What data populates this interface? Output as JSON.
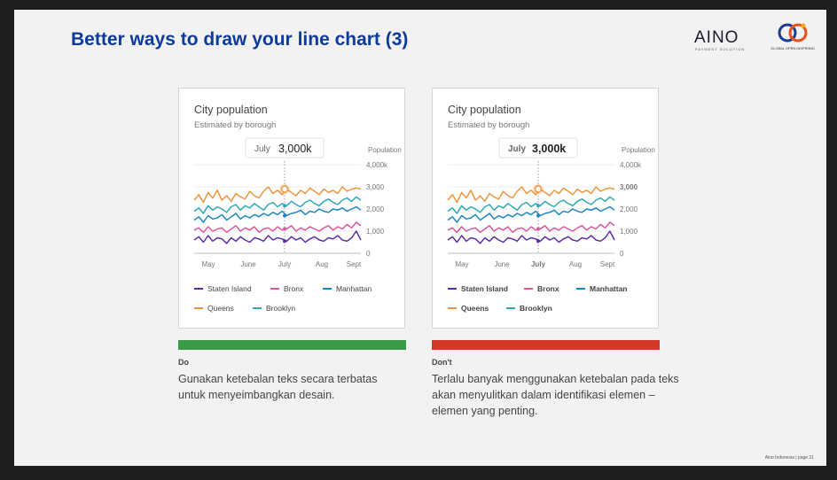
{
  "slide": {
    "title": "Better ways to draw your line chart (3)",
    "logos": {
      "aino_text": "AINO",
      "aino_tagline": "PAYMENT SOLUTION",
      "goi_text": "GLOBAL OPEN INSPIRING"
    },
    "footer": "Aino Indonesia | page 31"
  },
  "colors": {
    "title": "#0d3b9c",
    "do_bar": "#3a9a48",
    "dont_bar": "#d23a27",
    "staten_island": "#5b2ca8",
    "bronx": "#d9579b",
    "manhattan": "#1a86c6",
    "queens": "#f0943c",
    "brooklyn": "#2fa9b3",
    "highlight": "#f0943c"
  },
  "panels": [
    {
      "id": "do",
      "verdict": "Do",
      "description": "Gunakan ketebalan teks secara terbatas untuk menyeimbangkan desain.",
      "bold_emphasis": false
    },
    {
      "id": "dont",
      "verdict": "Don't",
      "description": "Terlalu banyak menggunakan ketebalan pada teks akan menyulitkan dalam identifikasi elemen – elemen yang penting.",
      "bold_emphasis": true
    }
  ],
  "chart_data": {
    "type": "line",
    "title": "City population",
    "subtitle": "Estimated by borough",
    "ylabel": "Population",
    "ylim": [
      0,
      4000
    ],
    "y_ticks": [
      "4,000k",
      "3,000",
      "2,000",
      "1,000",
      "0"
    ],
    "y_tick_values": [
      4000,
      3000,
      2000,
      1000,
      0
    ],
    "x_ticks": [
      "May",
      "June",
      "July",
      "Aug",
      "Sept"
    ],
    "tooltip": {
      "month": "July",
      "value": "3,000k"
    },
    "series": [
      {
        "name": "Staten Island",
        "color": "#5b2ca8",
        "values": [
          600,
          750,
          500,
          800,
          550,
          700,
          650,
          450,
          700,
          550,
          750,
          600,
          500,
          700,
          650,
          550,
          800,
          600,
          700,
          650,
          550,
          750,
          600,
          700,
          500,
          650,
          750,
          600,
          550,
          700,
          650,
          800,
          600,
          550,
          700,
          1000,
          600
        ]
      },
      {
        "name": "Bronx",
        "color": "#d9579b",
        "values": [
          1050,
          1150,
          950,
          1200,
          1000,
          1100,
          1150,
          950,
          1100,
          1250,
          1000,
          1150,
          1050,
          1200,
          950,
          1100,
          1150,
          1000,
          1200,
          1050,
          1100,
          1250,
          1000,
          1150,
          1050,
          1200,
          1100,
          1000,
          1150,
          1250,
          1050,
          1200,
          1100,
          1300,
          1150,
          1400,
          1250
        ]
      },
      {
        "name": "Manhattan",
        "color": "#1a86c6",
        "values": [
          1500,
          1650,
          1400,
          1700,
          1550,
          1600,
          1750,
          1500,
          1650,
          1800,
          1550,
          1700,
          1600,
          1750,
          1650,
          1800,
          1700,
          1850,
          1750,
          1900,
          1700,
          1800,
          1850,
          1950,
          1750,
          1900,
          1850,
          2000,
          1900,
          1850,
          2000,
          1950,
          2050,
          1900,
          2000,
          2100,
          1950
        ]
      },
      {
        "name": "Queens",
        "color": "#f0943c",
        "values": [
          2400,
          2650,
          2300,
          2750,
          2500,
          2850,
          2400,
          2600,
          2350,
          2700,
          2550,
          2450,
          2800,
          2600,
          2500,
          2800,
          3000,
          2700,
          2850,
          2650,
          2900,
          2750,
          2600,
          2850,
          2700,
          2950,
          2800,
          2650,
          2900,
          2750,
          2850,
          2700,
          3000,
          2800,
          2900,
          2950,
          2900
        ]
      },
      {
        "name": "Brooklyn",
        "color": "#2fa9b3",
        "values": [
          1900,
          2050,
          1800,
          2150,
          1950,
          2100,
          2000,
          1850,
          2100,
          2200,
          1950,
          2150,
          2050,
          2250,
          2100,
          1950,
          2200,
          2300,
          2100,
          2250,
          2150,
          2350,
          2200,
          2100,
          2300,
          2400,
          2250,
          2150,
          2350,
          2450,
          2300,
          2200,
          2400,
          2500,
          2350,
          2550,
          2400
        ]
      }
    ],
    "legend": [
      "Staten Island",
      "Bronx",
      "Manhattan",
      "Queens",
      "Brooklyn"
    ]
  }
}
